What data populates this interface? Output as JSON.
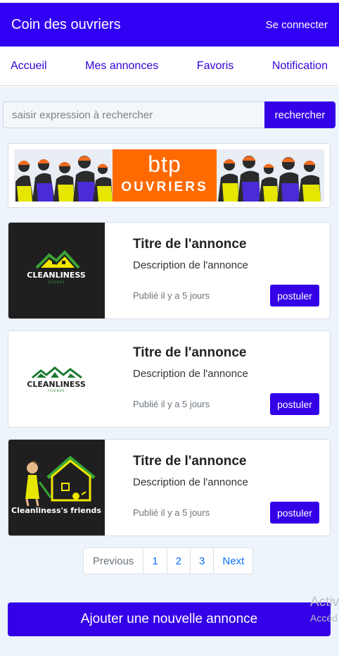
{
  "header": {
    "title": "Coin des ouvriers",
    "login_label": "Se connecter"
  },
  "nav": [
    "Accueil",
    "Mes annonces",
    "Favoris",
    "Notification"
  ],
  "search": {
    "placeholder": "saisir expression à rechercher",
    "button_label": "rechercher"
  },
  "banner": {
    "logo_big": "btp",
    "logo_small": "OUVRIERS"
  },
  "listings": [
    {
      "title": "Titre de l'annonce",
      "description": "Description de l'annonce",
      "date": "Publié il y a 5 jours",
      "button": "postuler",
      "logo_text": "CLEANLINESS",
      "logo_sub": "FRIENDS"
    },
    {
      "title": "Titre de l'annonce",
      "description": "Description de l'annonce",
      "date": "Publié il y a 5 jours",
      "button": "postuler",
      "logo_text": "CLEANLINESS",
      "logo_sub": "FRIENDS"
    },
    {
      "title": "Titre de l'annonce",
      "description": "Description de l'annonce",
      "date": "Publié il y a 5 jours",
      "button": "postuler",
      "logo_text": "Cleanliness's friends"
    }
  ],
  "pagination": [
    "Previous",
    "1",
    "2",
    "3",
    "Next"
  ],
  "add_button": "Ajouter une nouvelle annonce",
  "watermark": {
    "line1": "Activ",
    "line2": "Accéd"
  },
  "colors": {
    "primary": "#3300e8",
    "header": "#3100f4",
    "banner_orange": "#ff6a00",
    "background": "#eef4fb"
  }
}
